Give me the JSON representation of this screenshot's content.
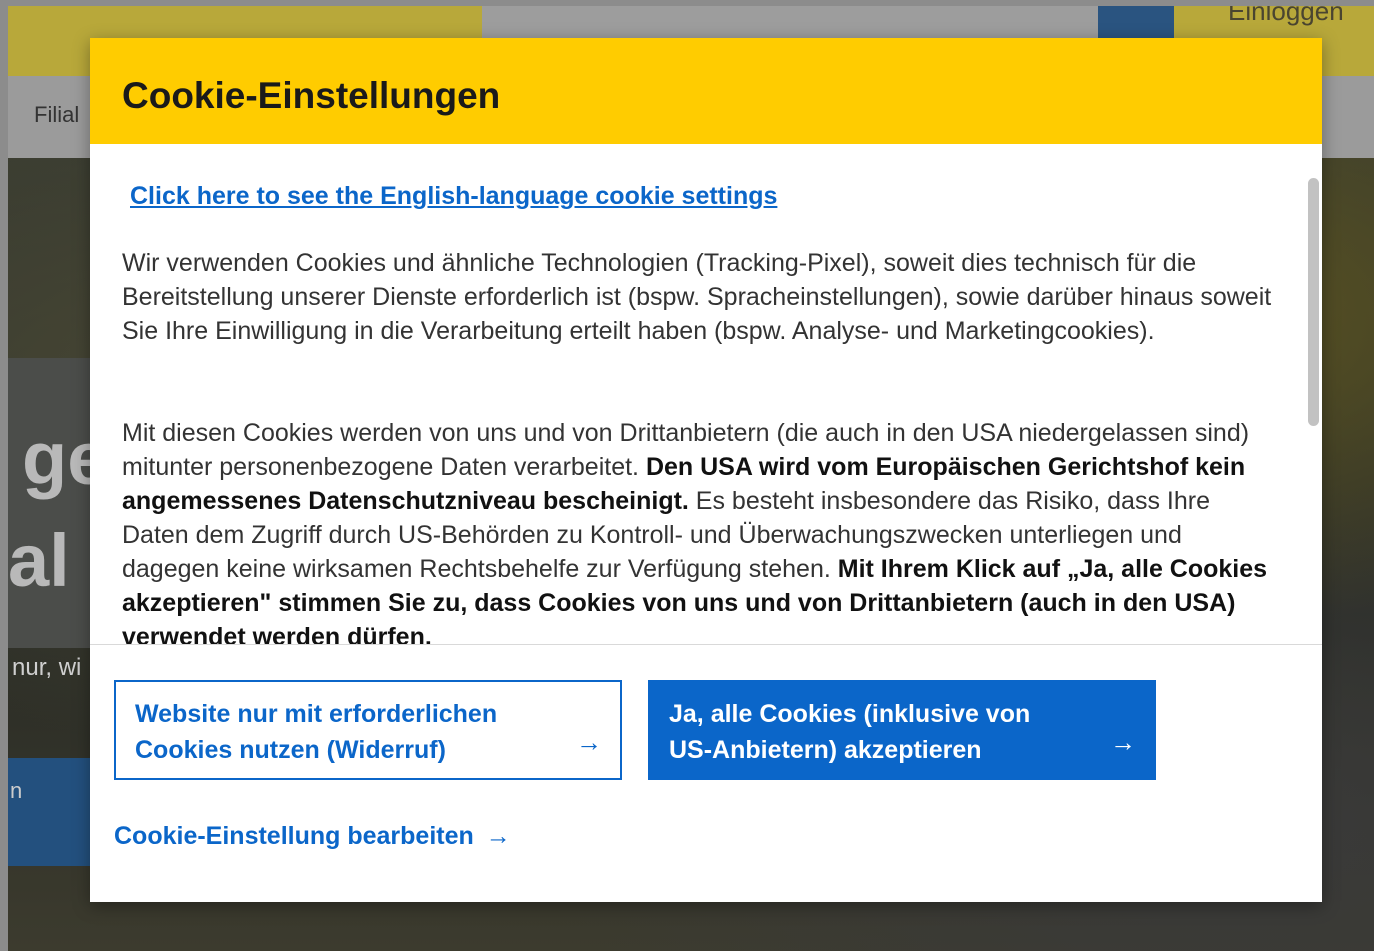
{
  "background": {
    "login_fragment": "Einloggen",
    "nav_item": "Filial",
    "headline_line1": "ge",
    "headline_line2": "al",
    "subline": "nur, wi",
    "cta_fragment": "n"
  },
  "modal": {
    "title": "Cookie-Einstellungen",
    "english_link": "Click here to see the English-language cookie settings",
    "paragraph1": "Wir verwenden Cookies und ähnliche Technologien (Tracking-Pixel), soweit dies technisch für die Bereitstellung unserer Dienste erforderlich ist (bspw. Spracheinstellungen), sowie darüber hinaus soweit Sie Ihre Einwilligung in die Verarbeitung erteilt haben (bspw. Analyse- und Marketingcookies).",
    "paragraph2": {
      "part1": "Mit diesen Cookies werden von uns und von Drittanbietern (die auch in den USA niedergelassen sind) mitunter personenbezogene Daten verarbeitet. ",
      "bold1": "Den USA wird vom Europäischen Gerichtshof kein angemessenes Datenschutzniveau bescheinigt.",
      "part2": " Es besteht insbesondere das Risiko, dass Ihre Daten dem Zugriff durch US-Behörden zu Kontroll- und Überwachungszwecken unterliegen und dagegen keine wirksamen Rechtsbehelfe zur Verfügung stehen. ",
      "bold2": "Mit Ihrem Klick auf „Ja, alle Cookies akzeptieren\" stimmen Sie zu, dass Cookies von uns und von Drittanbietern (auch in den USA) verwendet werden dürfen."
    },
    "buttons": {
      "necessary_only": "Website nur mit erforderlichen Cookies nutzen (Widerruf)",
      "accept_all": "Ja, alle Cookies (inklusive von US-Anbietern) akzeptieren",
      "arrow": "→"
    },
    "edit_link": "Cookie-Einstellung bearbeiten",
    "edit_arrow": "→"
  },
  "colors": {
    "brand_yellow": "#ffcc00",
    "link_blue": "#0b66c9",
    "text": "#333333"
  },
  "scroll": {
    "thumb_fraction": 0.5,
    "position_fraction": 0.0
  }
}
